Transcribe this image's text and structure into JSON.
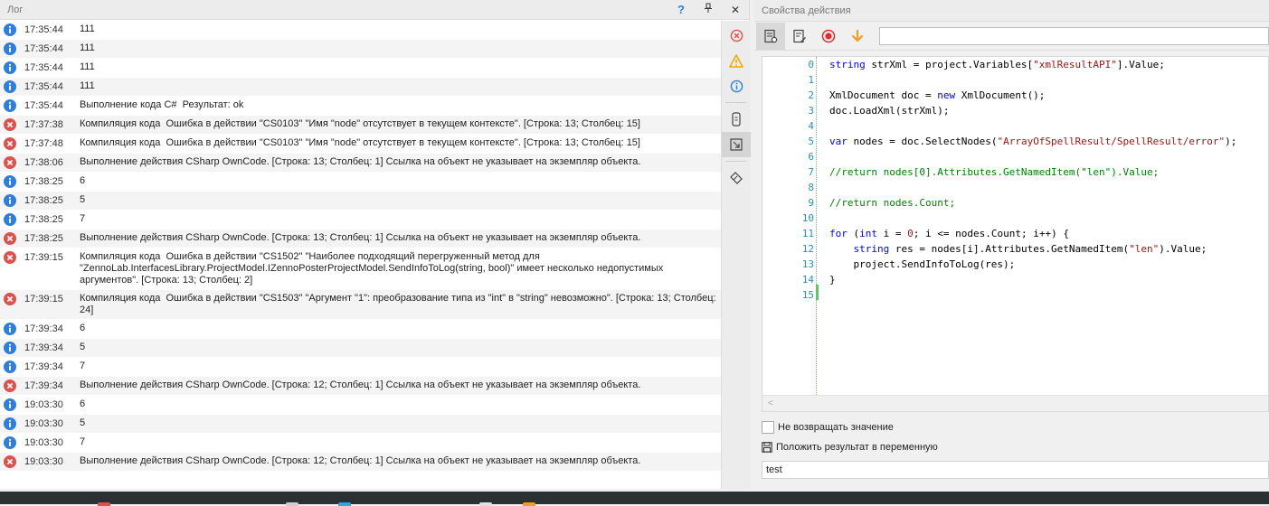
{
  "log_panel": {
    "title": "Лог",
    "help_label": "?",
    "pin_label": "⊥",
    "close_label": "✕",
    "rows": [
      {
        "type": "info",
        "time": "17:35:44",
        "msg": "111"
      },
      {
        "type": "info",
        "time": "17:35:44",
        "msg": "111"
      },
      {
        "type": "info",
        "time": "17:35:44",
        "msg": "111"
      },
      {
        "type": "info",
        "time": "17:35:44",
        "msg": "111"
      },
      {
        "type": "info",
        "time": "17:35:44",
        "msg": "Выполнение кода C#  Результат: ok"
      },
      {
        "type": "error",
        "time": "17:37:38",
        "msg": "Компиляция кода  Ошибка в действии \"CS0103\" \"Имя \"node\" отсутствует в текущем контексте\". [Строка: 13; Столбец: 15]"
      },
      {
        "type": "error",
        "time": "17:37:48",
        "msg": "Компиляция кода  Ошибка в действии \"CS0103\" \"Имя \"node\" отсутствует в текущем контексте\". [Строка: 13; Столбец: 15]"
      },
      {
        "type": "error",
        "time": "17:38:06",
        "msg": "Выполнение действия CSharp OwnCode. [Строка: 13; Столбец: 1] Ссылка на объект не указывает на экземпляр объекта."
      },
      {
        "type": "info",
        "time": "17:38:25",
        "msg": "6"
      },
      {
        "type": "info",
        "time": "17:38:25",
        "msg": "5"
      },
      {
        "type": "info",
        "time": "17:38:25",
        "msg": "7"
      },
      {
        "type": "error",
        "time": "17:38:25",
        "msg": "Выполнение действия CSharp OwnCode. [Строка: 13; Столбец: 1] Ссылка на объект не указывает на экземпляр объекта."
      },
      {
        "type": "error",
        "time": "17:39:15",
        "msg": "Компиляция кода  Ошибка в действии \"CS1502\" \"Наиболее подходящий перегруженный метод для \"ZennoLab.InterfacesLibrary.ProjectModel.IZennoPosterProjectModel.SendInfoToLog(string, bool)\" имеет несколько недопустимых аргументов\". [Строка: 13; Столбец: 2]"
      },
      {
        "type": "error",
        "time": "17:39:15",
        "msg": "Компиляция кода  Ошибка в действии \"CS1503\" \"Аргумент \"1\": преобразование типа из \"int\" в \"string\" невозможно\". [Строка: 13; Столбец: 24]"
      },
      {
        "type": "info",
        "time": "17:39:34",
        "msg": "6"
      },
      {
        "type": "info",
        "time": "17:39:34",
        "msg": "5"
      },
      {
        "type": "info",
        "time": "17:39:34",
        "msg": "7"
      },
      {
        "type": "error",
        "time": "17:39:34",
        "msg": "Выполнение действия CSharp OwnCode. [Строка: 12; Столбец: 1] Ссылка на объект не указывает на экземпляр объекта."
      },
      {
        "type": "info",
        "time": "19:03:30",
        "msg": "6"
      },
      {
        "type": "info",
        "time": "19:03:30",
        "msg": "5"
      },
      {
        "type": "info",
        "time": "19:03:30",
        "msg": "7"
      },
      {
        "type": "error",
        "time": "19:03:30",
        "msg": "Выполнение действия CSharp OwnCode. [Строка: 12; Столбец: 1] Ссылка на объект не указывает на экземпляр объекта."
      }
    ]
  },
  "side_toolbar": {
    "icons": [
      "error-filter-icon",
      "warning-filter-icon",
      "info-filter-icon",
      "device-icon",
      "fit-screen-icon",
      "clear-log-icon"
    ]
  },
  "props_panel": {
    "title": "Свойства действия",
    "toolbar_input_value": "",
    "code_lines": [
      [
        {
          "t": "string",
          "c": "kw"
        },
        {
          "t": " strXml = project.Variables[",
          "c": ""
        },
        {
          "t": "\"xmlResultAPI\"",
          "c": "str"
        },
        {
          "t": "].Value;",
          "c": ""
        }
      ],
      [],
      [
        {
          "t": "XmlDocument doc = ",
          "c": ""
        },
        {
          "t": "new",
          "c": "kw"
        },
        {
          "t": " XmlDocument();",
          "c": ""
        }
      ],
      [
        {
          "t": "doc.LoadXml(strXml);",
          "c": ""
        }
      ],
      [],
      [
        {
          "t": "var",
          "c": "kw"
        },
        {
          "t": " nodes = doc.SelectNodes(",
          "c": ""
        },
        {
          "t": "\"ArrayOfSpellResult/SpellResult/error\"",
          "c": "str"
        },
        {
          "t": ");",
          "c": ""
        }
      ],
      [],
      [
        {
          "t": "//return nodes[0].Attributes.GetNamedItem(\"len\").Value;",
          "c": "cm"
        }
      ],
      [],
      [
        {
          "t": "//return nodes.Count;",
          "c": "cm"
        }
      ],
      [],
      [
        {
          "t": "for",
          "c": "kw"
        },
        {
          "t": " (",
          "c": ""
        },
        {
          "t": "int",
          "c": "kw"
        },
        {
          "t": " i = ",
          "c": ""
        },
        {
          "t": "0",
          "c": "str"
        },
        {
          "t": "; i <= nodes.Count; i++) {",
          "c": ""
        }
      ],
      [
        {
          "t": "    ",
          "c": ""
        },
        {
          "t": "string",
          "c": "kw"
        },
        {
          "t": " res = nodes[i].Attributes.GetNamedItem(",
          "c": ""
        },
        {
          "t": "\"len\"",
          "c": "str"
        },
        {
          "t": ").Value;",
          "c": ""
        }
      ],
      [
        {
          "t": "    project.SendInfoToLog(res);",
          "c": ""
        }
      ],
      [
        {
          "t": "}",
          "c": ""
        }
      ],
      []
    ],
    "line_numbers": [
      "0",
      "1",
      "2",
      "3",
      "4",
      "5",
      "6",
      "7",
      "8",
      "9",
      "10",
      "11",
      "12",
      "13",
      "14",
      "15"
    ],
    "scroll_left_label": "<",
    "no_return_label": "Не возвращать значение",
    "save_result_label": "Положить результат в переменную",
    "result_variable": "test"
  },
  "colors": {
    "info": "#2f7ed8",
    "error": "#d9534f",
    "warning": "#f0a800",
    "record": "#e02d2d",
    "arrow": "#f0a020"
  }
}
